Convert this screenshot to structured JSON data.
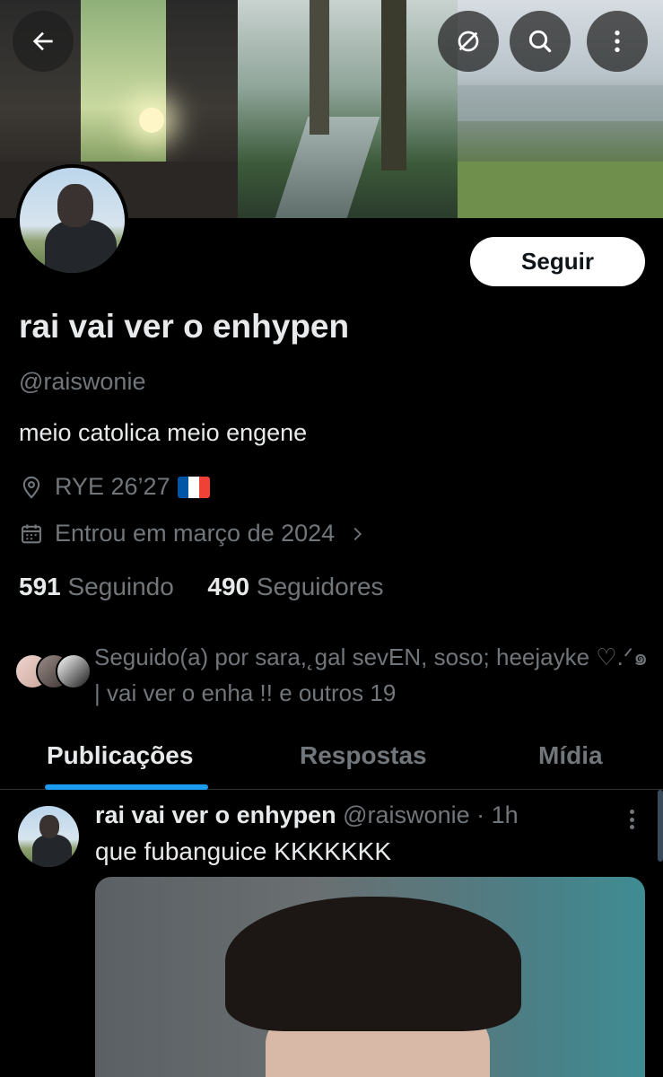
{
  "header": {
    "back_icon": "arrow-left-icon",
    "grok_icon": "slash-circle-icon",
    "search_icon": "search-icon",
    "more_icon": "more-vertical-icon"
  },
  "profile": {
    "follow_label": "Seguir",
    "display_name": "rai vai ver o enhypen",
    "handle": "@raiswonie",
    "bio": "meio catolica meio engene",
    "location": "RYE 26’27",
    "location_flag": "flag-france",
    "joined": "Entrou em março de 2024",
    "following_count": "591",
    "following_label": "Seguindo",
    "followers_count": "490",
    "followers_label": "Seguidores",
    "followed_by": "Seguido(a) por sara,˛gal sevEN, soso; heejayke ♡.ᐟ๑ | vai ver o enha !! e outros 19"
  },
  "tabs": [
    {
      "label": "Publicações",
      "active": true
    },
    {
      "label": "Respostas",
      "active": false
    },
    {
      "label": "Mídia",
      "active": false
    }
  ],
  "post": {
    "name": "rai vai ver o enhypen",
    "handle_time": "@raiswonie · 1h",
    "text": "que fubanguice KKKKKKK"
  },
  "colors": {
    "background": "#000000",
    "primary_text": "#e7e9ea",
    "secondary_text": "#71767b",
    "accent": "#1d9bf0"
  }
}
